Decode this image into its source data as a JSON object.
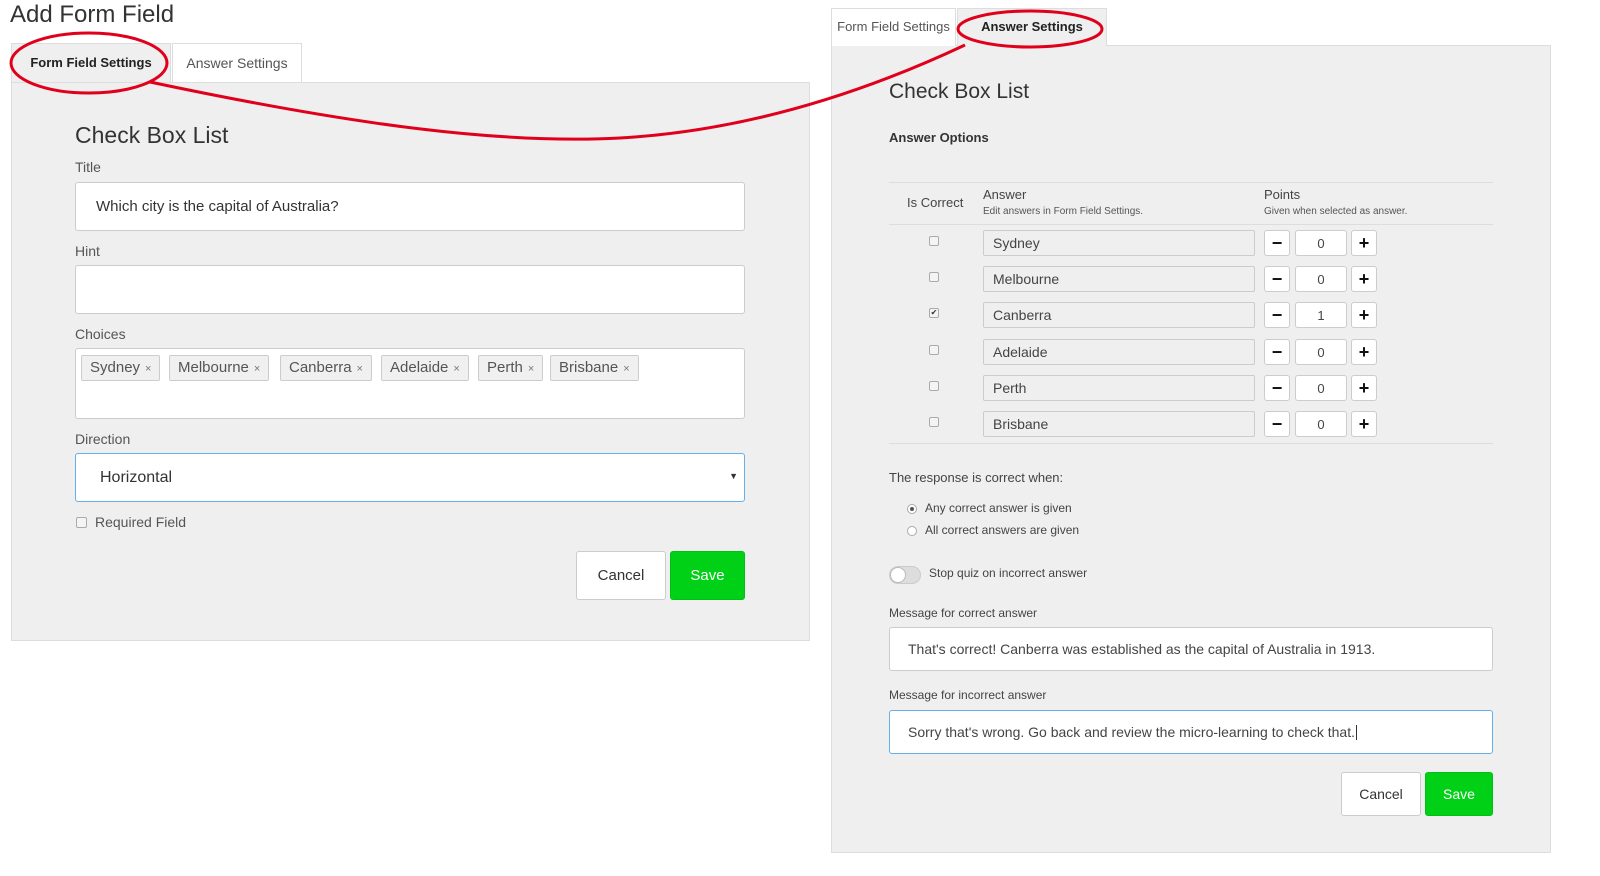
{
  "left": {
    "page_title": "Add Form Field",
    "tabs": [
      {
        "label": "Form Field Settings",
        "active": true
      },
      {
        "label": "Answer Settings",
        "active": false
      }
    ],
    "heading": "Check Box List",
    "title_label": "Title",
    "title_value": "Which city is the capital of Australia?",
    "hint_label": "Hint",
    "hint_value": "",
    "choices_label": "Choices",
    "choices": [
      "Sydney",
      "Melbourne",
      "Canberra",
      "Adelaide",
      "Perth",
      "Brisbane"
    ],
    "chip_remove_glyph": "×",
    "direction_label": "Direction",
    "direction_value": "Horizontal",
    "required_label": "Required Field",
    "required_checked": false,
    "cancel_label": "Cancel",
    "save_label": "Save"
  },
  "right": {
    "tabs": [
      {
        "label": "Form Field Settings",
        "active": false
      },
      {
        "label": "Answer Settings",
        "active": true
      }
    ],
    "heading": "Check Box List",
    "section_title": "Answer Options",
    "col_is_correct": "Is Correct",
    "col_answer": "Answer",
    "col_answer_hint": "Edit answers in Form Field Settings.",
    "col_points": "Points",
    "col_points_hint": "Given when selected as answer.",
    "rows": [
      {
        "correct": false,
        "answer": "Sydney",
        "points": "0"
      },
      {
        "correct": false,
        "answer": "Melbourne",
        "points": "0"
      },
      {
        "correct": true,
        "answer": "Canberra",
        "points": "1"
      },
      {
        "correct": false,
        "answer": "Adelaide",
        "points": "0"
      },
      {
        "correct": false,
        "answer": "Perth",
        "points": "0"
      },
      {
        "correct": false,
        "answer": "Brisbane",
        "points": "0"
      }
    ],
    "minus_glyph": "−",
    "plus_glyph": "+",
    "check_glyph": "✔",
    "response_label": "The response is correct when:",
    "radio_any": "Any correct answer is given",
    "radio_all": "All correct answers are given",
    "radio_selected": "any",
    "stop_quiz_label": "Stop quiz on incorrect answer",
    "stop_quiz_on": false,
    "correct_msg_label": "Message for correct answer",
    "correct_msg_value": "That's correct! Canberra was established as the capital of Australia in 1913.",
    "incorrect_msg_label": "Message for incorrect answer",
    "incorrect_msg_value": "Sorry that's wrong. Go back and review the micro-learning to check that.",
    "cancel_label": "Cancel",
    "save_label": "Save"
  },
  "colors": {
    "save_green": "#00d016",
    "annotation_red": "#e0001b",
    "focus_blue": "#66afe9",
    "panel_gray": "#efefef"
  }
}
